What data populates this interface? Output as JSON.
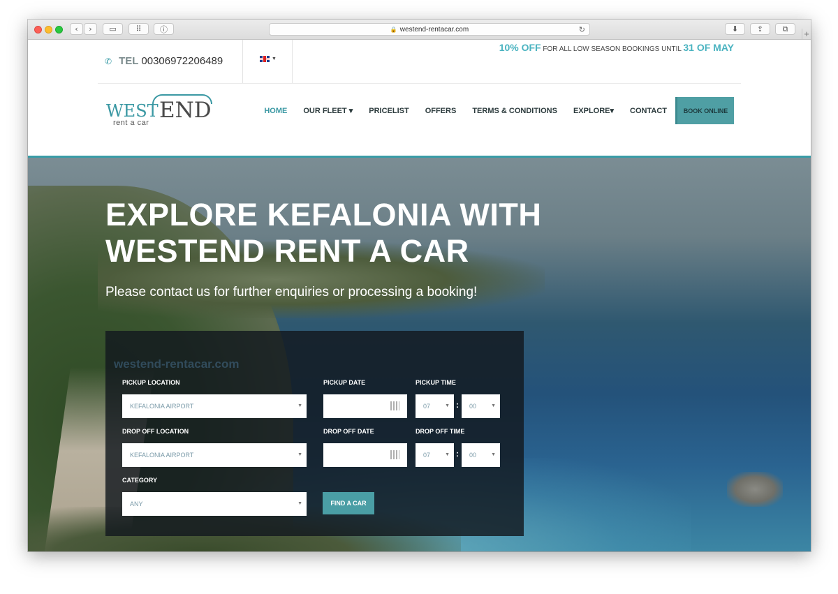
{
  "browser": {
    "url": "westend-rentacar.com"
  },
  "topbar": {
    "tel_label": "TEL",
    "tel_number": "00306972206489",
    "promo_pct": "10% OFF",
    "promo_text": "FOR ALL LOW SEASON BOOKINGS UNTIL",
    "promo_date": "31 OF MAY"
  },
  "logo": {
    "part1": "WEST",
    "part2": "END",
    "sub": "rent a car"
  },
  "nav": {
    "items": [
      {
        "label": "HOME",
        "active": true
      },
      {
        "label": "OUR FLEET ▾"
      },
      {
        "label": "PRICELIST"
      },
      {
        "label": "OFFERS"
      },
      {
        "label": "TERMS & CONDITIONS"
      },
      {
        "label": "EXPLORE▾"
      },
      {
        "label": "CONTACT"
      }
    ],
    "book_online": "BOOK ONLINE"
  },
  "hero": {
    "title_line1": "EXPLORE KEFALONIA WITH",
    "title_line2": "WESTEND RENT A CAR",
    "subtitle": "Please contact us for further enquiries or processing a booking!"
  },
  "form": {
    "watermark": "westend-rentacar.com",
    "pickup_location_label": "PICKUP LOCATION",
    "pickup_location_value": "KEFALONIA AIRPORT",
    "pickup_date_label": "PICKUP DATE",
    "pickup_time_label": "PICKUP TIME",
    "pickup_hour": "07",
    "pickup_minute": "00",
    "dropoff_location_label": "DROP OFF LOCATION",
    "dropoff_location_value": "KEFALONIA AIRPORT",
    "dropoff_date_label": "DROP OFF DATE",
    "dropoff_time_label": "DROP OFF TIME",
    "dropoff_hour": "07",
    "dropoff_minute": "00",
    "category_label": "CATEGORY",
    "category_value": "ANY",
    "find_button": "FIND A CAR"
  },
  "colors": {
    "accent": "#3a98a3",
    "button": "#4a9ea5"
  }
}
